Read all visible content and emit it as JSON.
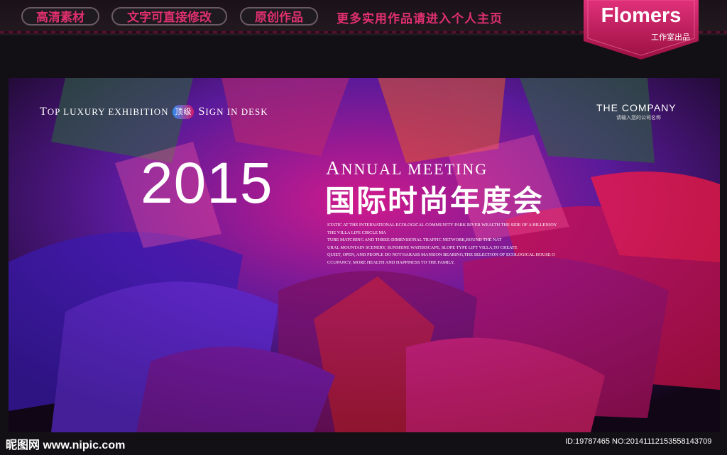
{
  "topbar": {
    "pills": [
      "高清素材",
      "文字可直接修改",
      "原创作品"
    ],
    "promo": "更多实用作品请进入个人主页"
  },
  "badge": {
    "logo": "Flomers",
    "sub": "工作室出品"
  },
  "poster": {
    "tagline_parts": [
      "T",
      "OP LUXURY EXHIBITION",
      "S",
      "IGN IN DESK"
    ],
    "tag_badge": "顶级",
    "company": "THE COMPANY",
    "company_sub": "请输入您的公司名称",
    "year": "2015",
    "annual_parts": [
      "A",
      "NNUAL MEETING"
    ],
    "title_cn": "国际时尚年度会",
    "body_lines": [
      "STATIC AT THE INTERNATIONAL ECOLOGICAL COMMUNITY PARK RIVER WEALTH THE SIDE OF A HILLENJOY",
      "THE VILLA LIFE CIRCLE MA",
      "TURE MATCHING AND THREE-DIMENSIONAL TRAFFIC NETWORK,ROUND THE NAT",
      "URAL MOUNTAIN SCENERY, SUNSHINE WATERSCAPE, SLOPE TYPE LIFT VILLA,TO CREATE",
      "QUIET, OPEN, AND PEOPLE DO NOT HARASS MANSION BEARING,THE SELECTION OF ECOLOGICAL HOUSE O",
      "CCUPANCY, MORE HEALTH AND HAPPINESS TO THE FAMILY."
    ]
  },
  "footer": {
    "left": "昵图网 www.nipic.com",
    "right": "ID:19787465 NO:20141112153558143709"
  },
  "colors": {
    "accent": "#e0306e",
    "bg": "#121014"
  }
}
